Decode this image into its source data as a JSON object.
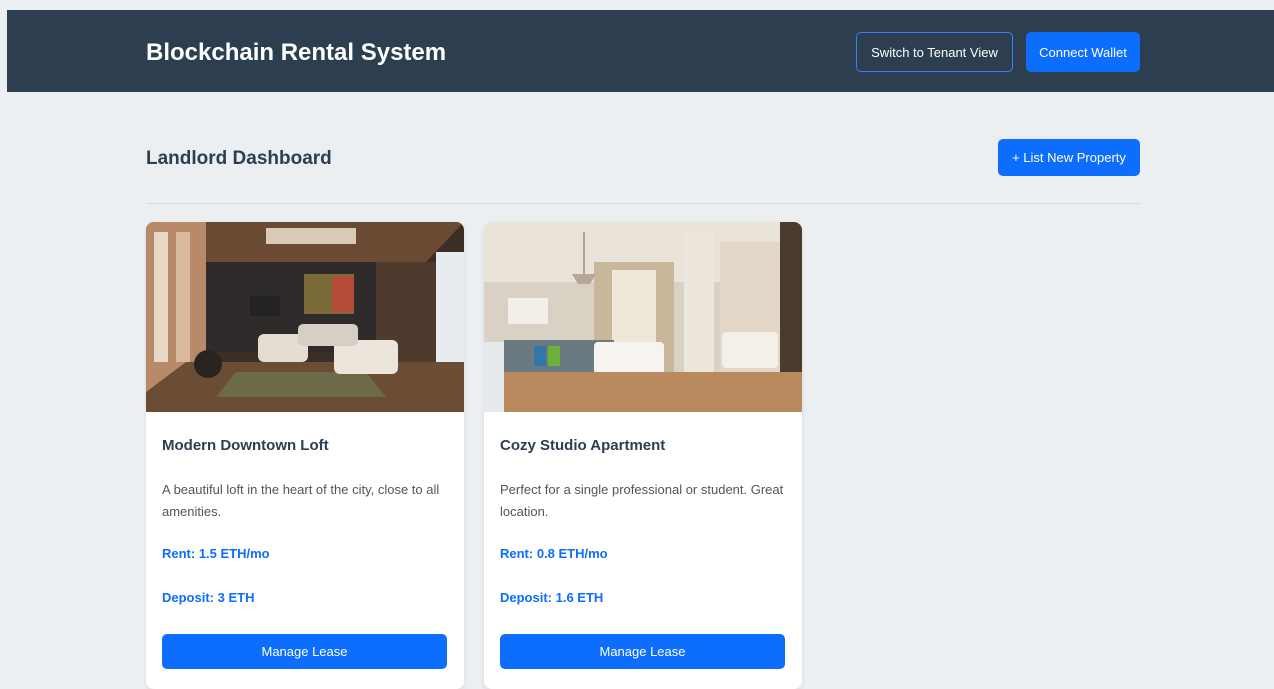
{
  "header": {
    "brand": "Blockchain Rental System",
    "switch_view_label": "Switch to Tenant View",
    "connect_wallet_label": "Connect Wallet"
  },
  "dashboard": {
    "title": "Landlord Dashboard",
    "list_property_label": "+ List New Property"
  },
  "properties": [
    {
      "title": "Modern Downtown Loft",
      "description": "A beautiful loft in the heart of the city, close to all amenities.",
      "rent": "Rent: 1.5 ETH/mo",
      "deposit": "Deposit: 3 ETH",
      "button_label": "Manage Lease"
    },
    {
      "title": "Cozy Studio Apartment",
      "description": "Perfect for a single professional or student. Great location.",
      "rent": "Rent: 0.8 ETH/mo",
      "deposit": "Deposit: 1.6 ETH",
      "button_label": "Manage Lease"
    }
  ],
  "colors": {
    "header_bg": "#2c3e50",
    "page_bg": "#eceff1",
    "accent": "#0d6efd"
  }
}
